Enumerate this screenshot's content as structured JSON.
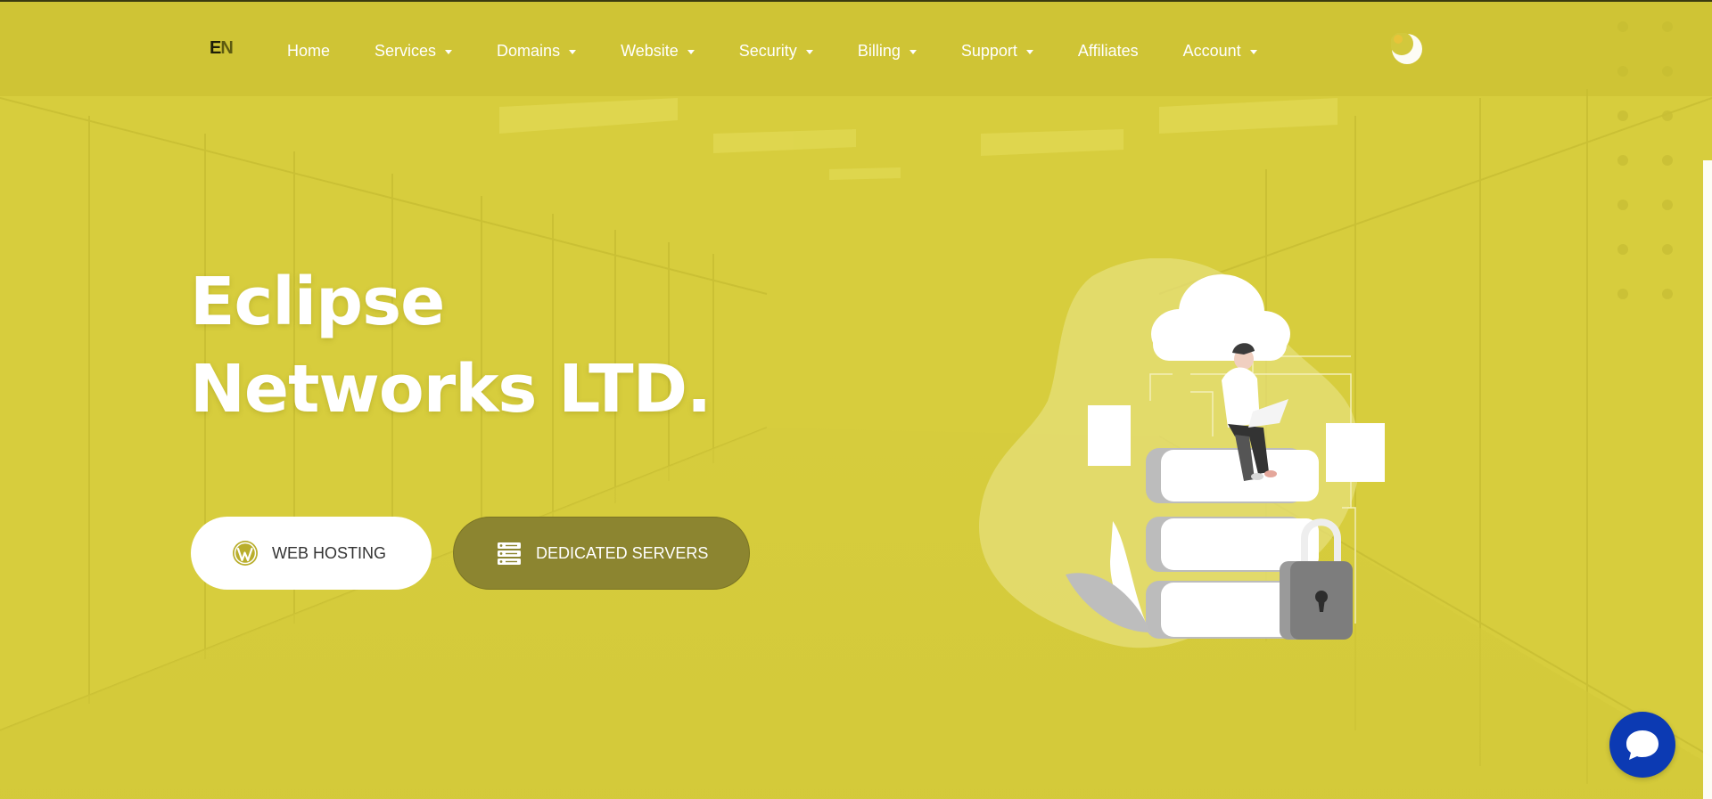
{
  "brand": {
    "logo_part1": "E",
    "logo_part2": "N"
  },
  "nav": {
    "items": [
      {
        "label": "Home",
        "dropdown": false
      },
      {
        "label": "Services",
        "dropdown": true
      },
      {
        "label": "Domains",
        "dropdown": true
      },
      {
        "label": "Website",
        "dropdown": true
      },
      {
        "label": "Security",
        "dropdown": true
      },
      {
        "label": "Billing",
        "dropdown": true
      },
      {
        "label": "Support",
        "dropdown": true
      },
      {
        "label": "Affiliates",
        "dropdown": false
      },
      {
        "label": "Account",
        "dropdown": true
      }
    ],
    "theme_toggle_icon": "moon-icon"
  },
  "hero": {
    "title_line1": "Eclipse",
    "title_line2": "Networks LTD.",
    "buttons": {
      "web_hosting": {
        "label": "WEB HOSTING",
        "icon": "wordpress-icon"
      },
      "dedicated_servers": {
        "label": "DEDICATED SERVERS",
        "icon": "server-icon"
      }
    },
    "illustration": "cloud-server-security-illustration"
  },
  "chat": {
    "icon": "chat-bubble-icon"
  },
  "colors": {
    "hero_overlay": "#d8ce3c",
    "button_dark": "#8c8530",
    "chat": "#0c3ab3",
    "text": "#ffffff"
  }
}
